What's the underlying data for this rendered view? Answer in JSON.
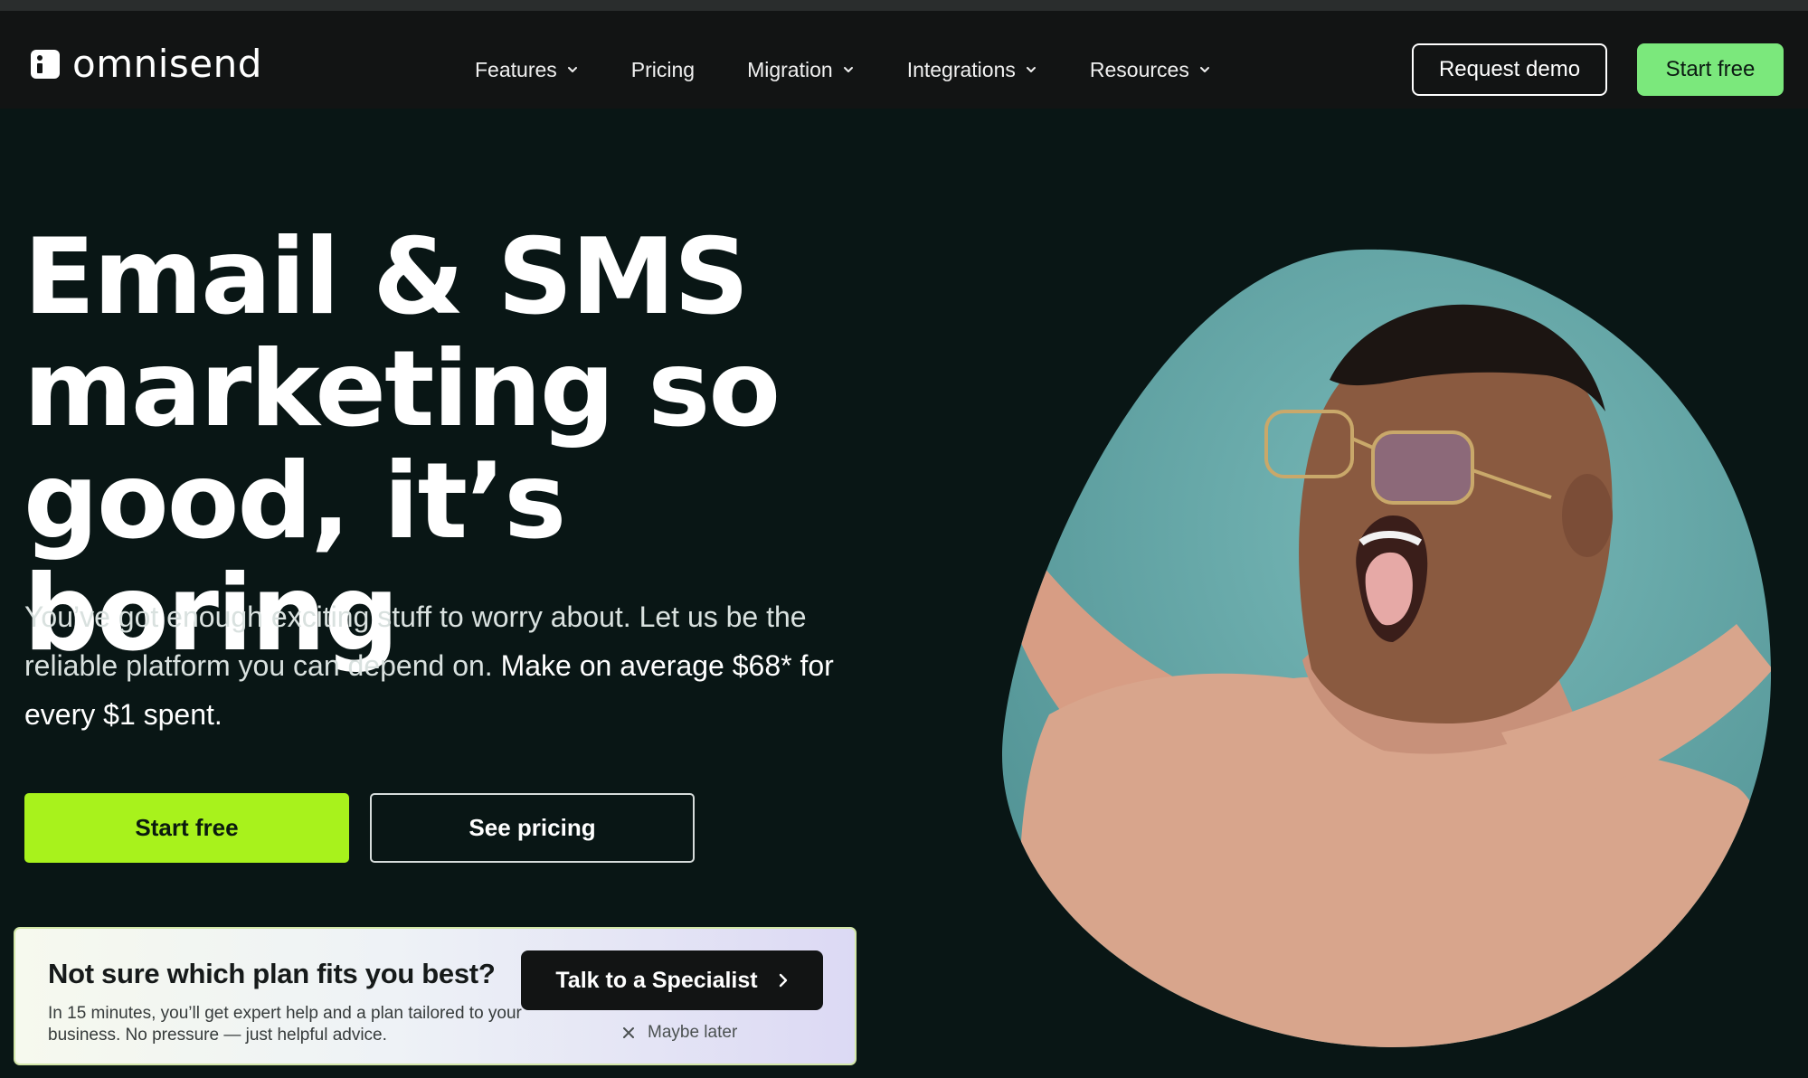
{
  "nav": {
    "logo_text": "omnisend",
    "menu": [
      {
        "label": "Features",
        "has_dropdown": true
      },
      {
        "label": "Pricing",
        "has_dropdown": false
      },
      {
        "label": "Migration",
        "has_dropdown": true
      },
      {
        "label": "Integrations",
        "has_dropdown": true
      },
      {
        "label": "Resources",
        "has_dropdown": true
      }
    ],
    "request_demo_label": "Request demo",
    "start_free_label": "Start free"
  },
  "hero": {
    "title_lines": [
      "Email & SMS",
      "marketing so",
      "good, it’s boring"
    ],
    "subtitle_plain": "You’ve got enough exciting stuff to worry about. Let us be the reliable platform you can depend on.",
    "subtitle_strong": "Make on average $68* for every $1 spent.",
    "start_free_label": "Start free",
    "see_pricing_label": "See pricing"
  },
  "promo": {
    "title": "Not sure which plan fits you best?",
    "text": "In 15 minutes, you’ll get expert help and a plan tailored to your business. No pressure — just helpful advice.",
    "cta_label": "Talk to a Specialist",
    "dismiss_label": "Maybe later"
  },
  "colors": {
    "page_bg": "#091615",
    "nav_bg": "#121414",
    "nav_cta": "#7be87c",
    "hero_cta": "#a8f21c",
    "photo_bg": "#5b9e9e"
  },
  "icons": {
    "chevron": "chevron-down-icon",
    "arrow": "chevron-right-icon",
    "close": "close-icon"
  }
}
